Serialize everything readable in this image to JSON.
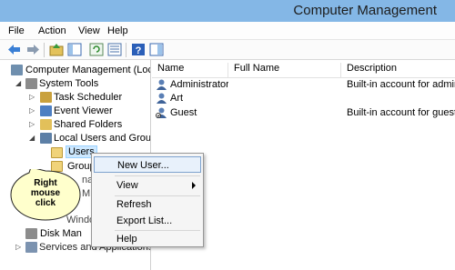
{
  "window": {
    "title": "Computer Management"
  },
  "menu": {
    "items": [
      "File",
      "Action",
      "View",
      "Help"
    ]
  },
  "toolbar": {
    "buttons": [
      "back-icon",
      "forward-icon",
      "up-folder-icon",
      "show-hide-tree-icon",
      "refresh-icon",
      "export-list-icon",
      "help-icon",
      "console-pane-icon"
    ]
  },
  "tree": {
    "items": [
      {
        "label": "Computer Management (Local"
      },
      {
        "label": "System Tools"
      },
      {
        "label": "Task Scheduler"
      },
      {
        "label": "Event Viewer"
      },
      {
        "label": "Shared Folders"
      },
      {
        "label": "Local Users and Groups"
      },
      {
        "label": "Users"
      },
      {
        "label": "Group"
      },
      {
        "label": "Windows"
      },
      {
        "label": "Disk Man"
      },
      {
        "label": "Services and Applications"
      }
    ]
  },
  "list": {
    "columns": [
      "Name",
      "Full Name",
      "Description"
    ],
    "rows": [
      {
        "name": "Administrator",
        "full_name": "",
        "description": "Built-in account for admini"
      },
      {
        "name": "Art",
        "full_name": "",
        "description": ""
      },
      {
        "name": "Guest",
        "full_name": "",
        "description": "Built-in account for guest a"
      }
    ]
  },
  "context_menu": {
    "items": [
      "New User...",
      "View",
      "Refresh",
      "Export List...",
      "Help"
    ]
  },
  "callout": {
    "line1": "Right",
    "line2": "mouse",
    "line3": "click"
  },
  "colors": {
    "titlebar": "#84b7e6",
    "highlight": "#cde8ff",
    "arrow": "#e8141b"
  }
}
